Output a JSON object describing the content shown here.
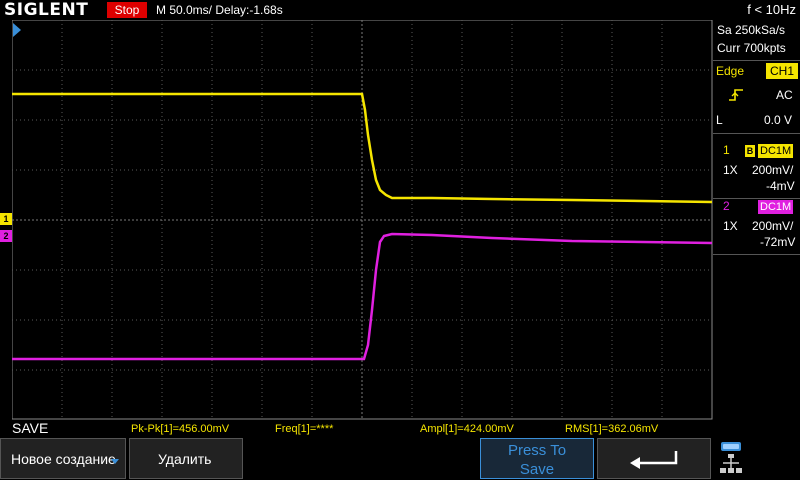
{
  "header": {
    "logo": "SIGLENT",
    "status": "Stop",
    "timebase": "M 50.0ms/ Delay:-1.68s",
    "frequency": "f < 10Hz"
  },
  "acquisition": {
    "sample_rate": "Sa 250kSa/s",
    "memory_depth": "Curr 700kpts"
  },
  "trigger": {
    "type": "Edge",
    "source": "CH1",
    "slope_icon": "rising-edge-icon",
    "coupling": "AC",
    "level_label": "L",
    "level_value": "0.0 V"
  },
  "channels": [
    {
      "number": "1",
      "bw_badge": "B",
      "coupling": "DC1M",
      "probe": "1X",
      "scale": "200mV/",
      "offset": "-4mV",
      "color": "#f5e500"
    },
    {
      "number": "2",
      "bw_badge": "",
      "coupling": "DC1M",
      "probe": "1X",
      "scale": "200mV/",
      "offset": "-72mV",
      "color": "#e020e0"
    }
  ],
  "markers": {
    "ch1": "1",
    "ch2": "2"
  },
  "measurements": {
    "menu_title": "SAVE",
    "pkpk": "Pk-Pk[1]=456.00mV",
    "freq": "Freq[1]=****",
    "ampl": "Ampl[1]=424.00mV",
    "rms": "RMS[1]=362.06mV"
  },
  "softkeys": {
    "new_create": "Новое создание",
    "delete": "Удалить",
    "press_to_save_line1": "Press To",
    "press_to_save_line2": "Save",
    "back_icon": "return-arrow-icon",
    "menu_icon": "network-menu-icon"
  },
  "colors": {
    "ch1": "#f5e500",
    "ch2": "#e020e0",
    "stop": "#dd0000",
    "accent": "#3a8fd8"
  }
}
